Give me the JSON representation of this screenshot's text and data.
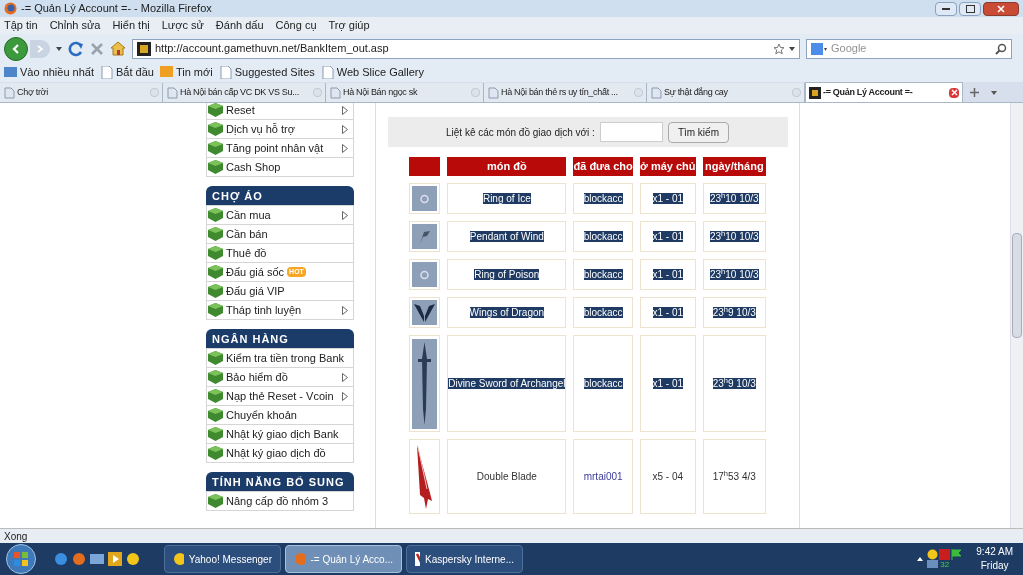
{
  "window": {
    "title": "-= Quản Lý Account =- - Mozilla Firefox"
  },
  "menu": [
    "Tập tin",
    "Chỉnh sửa",
    "Hiển thị",
    "Lược sử",
    "Đánh dấu",
    "Công cụ",
    "Trợ giúp"
  ],
  "address": {
    "value": "http://account.gamethuvn.net/BankItem_out.asp"
  },
  "search": {
    "placeholder": "Google"
  },
  "bookmarks": [
    "Vào nhiều nhất",
    "Bắt đầu",
    "Tin mới",
    "Suggested Sites",
    "Web Slice Gallery"
  ],
  "tabs": [
    {
      "label": "Chợ trời",
      "selected": false
    },
    {
      "label": "Hà Nội bán cấp VC DK VS Su...",
      "selected": false
    },
    {
      "label": "Hà Nội Bán ngọc sk",
      "selected": false
    },
    {
      "label": "Hà Nội bán thẻ rs uy tín_chất ...",
      "selected": false
    },
    {
      "label": "Sự thật đắng cay",
      "selected": false
    },
    {
      "label": "-= Quản Lý Account =-",
      "selected": true
    }
  ],
  "sidebar": [
    {
      "items": [
        {
          "label": "Reset",
          "submenu": true
        },
        {
          "label": "Dịch vụ hỗ trợ",
          "submenu": true
        },
        {
          "label": "Tăng point nhân vật",
          "submenu": true
        },
        {
          "label": "Cash Shop",
          "submenu": false
        }
      ]
    },
    {
      "title": "CHỢ ÁO",
      "items": [
        {
          "label": "Cần mua",
          "submenu": true
        },
        {
          "label": "Cần bán",
          "submenu": false
        },
        {
          "label": "Thuê đồ",
          "submenu": false
        },
        {
          "label": "Đấu giá sốc",
          "badge": "HOT",
          "submenu": false
        },
        {
          "label": "Đấu giá VIP",
          "submenu": false
        },
        {
          "label": "Tháp tinh luyện",
          "submenu": true
        }
      ]
    },
    {
      "title": "NGÂN HÀNG",
      "items": [
        {
          "label": "Kiểm tra tiền trong Bank",
          "submenu": false
        },
        {
          "label": "Bảo hiểm đồ",
          "submenu": true
        },
        {
          "label": "Nạp thẻ Reset - Vcoin",
          "submenu": true
        },
        {
          "label": "Chuyển khoản",
          "submenu": false
        },
        {
          "label": "Nhật ký giao dịch Bank",
          "submenu": false
        },
        {
          "label": "Nhật ký giao dịch đồ",
          "submenu": false
        }
      ]
    },
    {
      "title": "TÍNH NĂNG BỔ SUNG",
      "items": [
        {
          "label": "Nâng cấp đồ nhóm 3",
          "submenu": false
        }
      ]
    }
  ],
  "filter": {
    "label": "Liệt kê các món đồ giao dịch với :",
    "button": "Tìm kiếm"
  },
  "table": {
    "columns": [
      "món đồ",
      "đã đưa cho",
      "ở máy chủ",
      "ngày/tháng"
    ],
    "rows": [
      {
        "item": "Ring of Ice",
        "to": "blockacc",
        "server": "x1 - 01",
        "date": "23$^{h}$10 10/3",
        "highlighted": true
      },
      {
        "item": "Pendant of Wind",
        "to": "blockacc",
        "server": "x1 - 01",
        "date": "23$^{h}$10 10/3",
        "highlighted": true
      },
      {
        "item": "Ring of Poison",
        "to": "blockacc",
        "server": "x1 - 01",
        "date": "23$^{h}$10 10/3",
        "highlighted": true
      },
      {
        "item": "Wings of Dragon",
        "to": "blockacc",
        "server": "x1 - 01",
        "date": "23$^{h}$9 10/3",
        "highlighted": true
      },
      {
        "item": "Divine Sword of Archangel",
        "to": "blockacc",
        "server": "x1 - 01",
        "date": "23$^{h}$9 10/3",
        "highlighted": true
      },
      {
        "item": "Double Blade",
        "to": "mrtai001",
        "server": "x5 - 04",
        "date": "17$^{h}$53 4/3",
        "highlighted": false
      }
    ]
  },
  "status_bar": "Xong",
  "taskbar": {
    "buttons": [
      {
        "label": "Yahoo! Messenger",
        "selected": false
      },
      {
        "label": "-= Quản Lý Acco...",
        "selected": true
      },
      {
        "label": "Kaspersky Interne...",
        "selected": false
      }
    ],
    "tray_number": "32",
    "time": "9:42 AM",
    "day": "Friday"
  }
}
